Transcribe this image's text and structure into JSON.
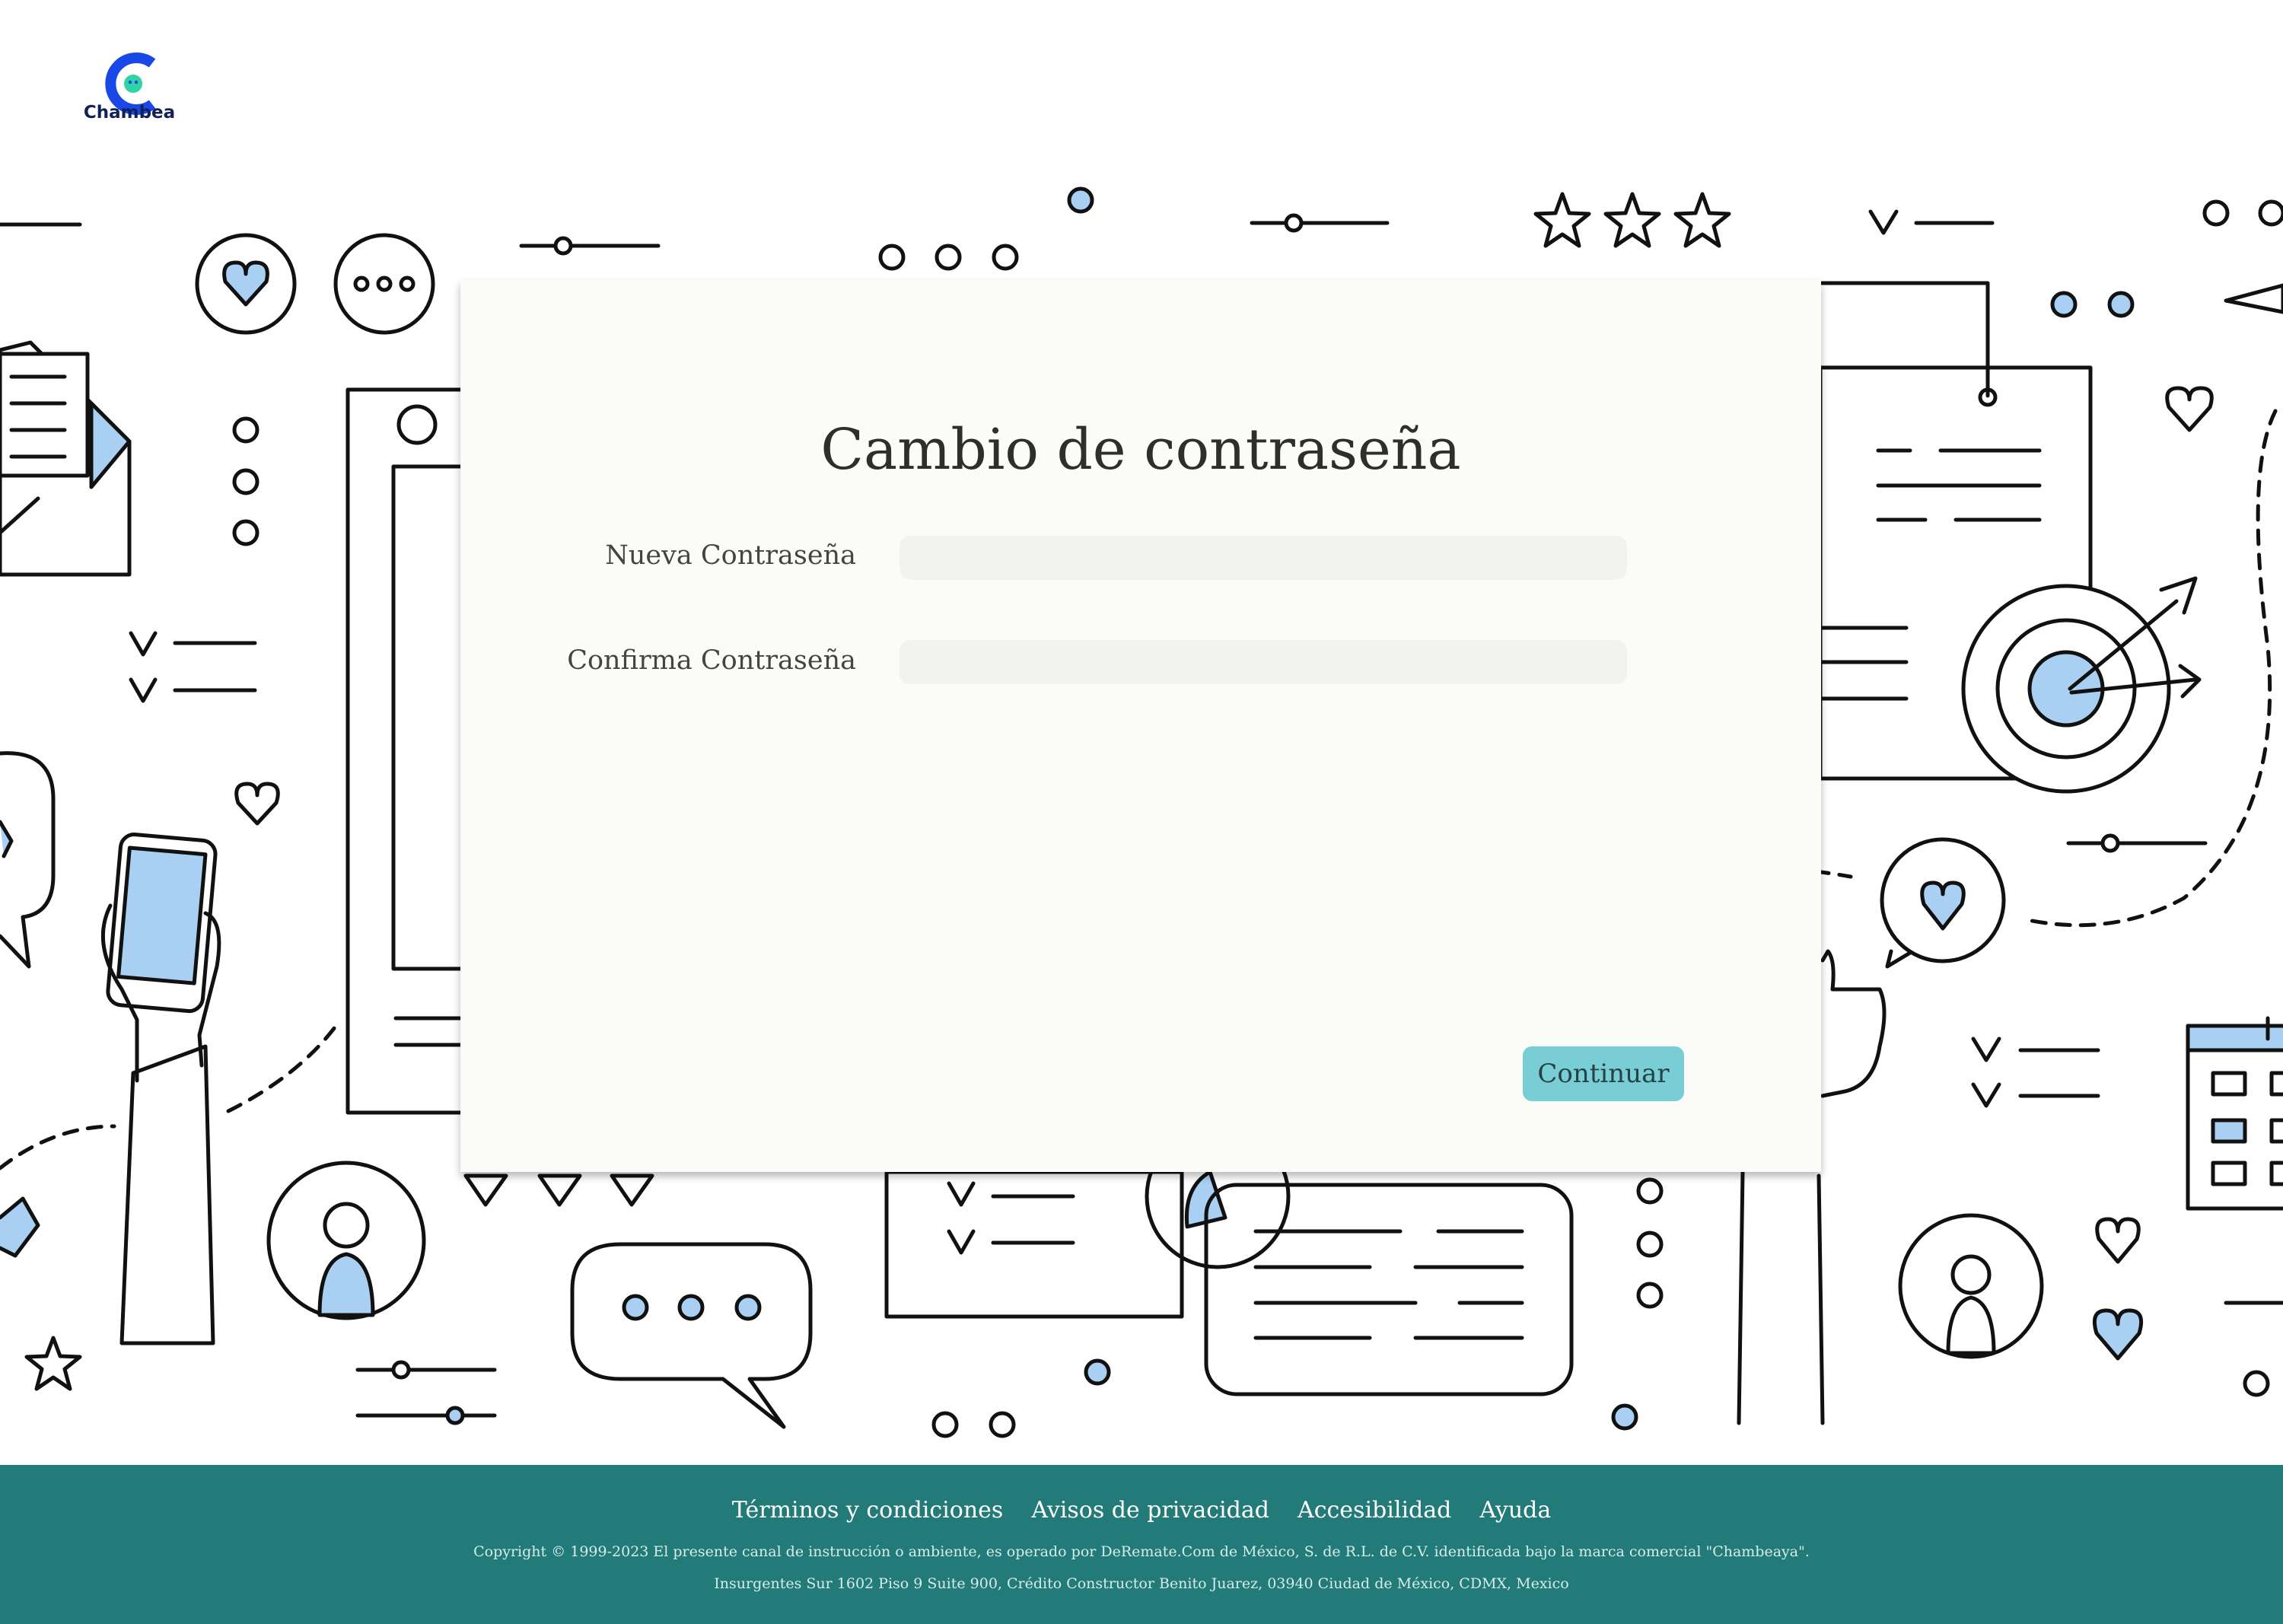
{
  "brand": {
    "name": "Chambea",
    "accent": "#1a47e8",
    "accent2": "#2fd3a6"
  },
  "form": {
    "title": "Cambio de contraseña",
    "new_password_label": "Nueva Contraseña",
    "confirm_password_label": "Confirma Contraseña",
    "new_password_value": "",
    "confirm_password_value": "",
    "submit_label": "Continuar"
  },
  "footer": {
    "links": [
      "Términos y condiciones",
      "Avisos de privacidad",
      "Accesibilidad",
      "Ayuda"
    ],
    "copyright": "Copyright © 1999-2023 El presente canal de instrucción o ambiente, es operado por DeRemate.Com de México, S. de R.L. de C.V. identificada bajo la marca comercial \"Chambeaya\".",
    "address": "Insurgentes Sur 1602 Piso 9 Suite 900, Crédito Constructor Benito Juarez, 03940 Ciudad de México, CDMX, Mexico"
  },
  "colors": {
    "footer_bg": "#237b79",
    "button_bg": "#79cdd5",
    "illustration_fill": "#a9d0f2",
    "card_bg": "#fbfbf7"
  }
}
